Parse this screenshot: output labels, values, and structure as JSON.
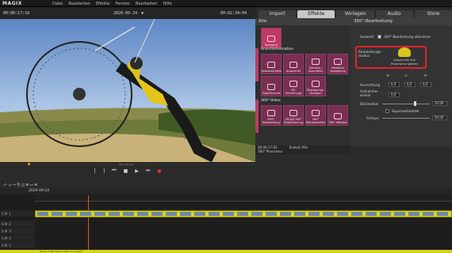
{
  "app": {
    "logo": "MAGIX",
    "menu": [
      "Datei",
      "Bearbeiten",
      "Effekte",
      "Fenster",
      "Bearbeiten",
      "Hilfe"
    ]
  },
  "preview": {
    "timecode_left": "00:00:17:10",
    "project_date": "2020-09-24",
    "timecode_right": "00:02:34:04",
    "scrub_time": "02:14:04"
  },
  "tabs": [
    {
      "label": "Import"
    },
    {
      "label": "Effekte"
    },
    {
      "label": "Vorlagen"
    },
    {
      "label": "Audio"
    },
    {
      "label": "Store"
    }
  ],
  "media": {
    "filter": "Alle",
    "categories": [
      {
        "label": "Ansicht/Animation"
      },
      {
        "label": "360°-Video"
      }
    ],
    "tiles_row1": [
      {
        "label": "Position/Größe"
      },
      {
        "label": "Ausschnitt"
      },
      {
        "label": "Kamera-/ Zoomfahrt"
      },
      {
        "label": "Rotation/ Spiegelung"
      }
    ],
    "tiles_row2": [
      {
        "label": "Objektivsicht"
      },
      {
        "label": "3D-Verformung"
      },
      {
        "label": "Bewegungs-Vorlagen"
      }
    ],
    "tiles_row3": [
      {
        "label": "360°-Bearbeitung"
      },
      {
        "label": "VEGAS 360° Stabilisierung"
      },
      {
        "label": "360° Stereostreifen"
      },
      {
        "label": "360° Mitblick"
      }
    ],
    "standard_tile": "Standard",
    "footer_time": "00:00:17:03",
    "footer_unit": "Einheit: Min",
    "footer_item": "360° Panorama"
  },
  "props": {
    "title": "360°-Bearbeitung",
    "auswahl_label": "Auswahl",
    "checkbox_label": "360°-Bearbeitung aktivieren",
    "mode_label": "Bearbeitungs-modus",
    "mode_value": "Ausschnitt aus Panorama wählen",
    "ausrichtung_label": "Ausrichtung",
    "aufnahme_label": "Aufnahme-winkel",
    "blickwinkel_label": "Blickwinkel",
    "blickwinkel_value": "20,00",
    "superweit_label": "Superweitwinkel",
    "fisheye_label": "Fisheye",
    "fisheye_value": "00,00",
    "val_a": "0,0",
    "val_b": "0,0",
    "val_c": "0,0"
  },
  "timeline": {
    "date": "2020-09-24",
    "marker_time": "00:00:04:03",
    "clip_title": "Bruno V 360 Bruno Video 9 c3.mp4",
    "track_numbers": [
      "1",
      "2",
      "3",
      "4",
      "5"
    ]
  },
  "colors": {
    "accent": "#c03a67",
    "clip": "#d8d21a",
    "highlight": "#e3212b"
  }
}
